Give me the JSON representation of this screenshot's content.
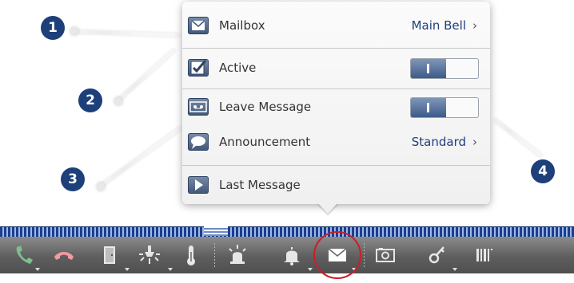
{
  "callouts": [
    "1",
    "2",
    "3",
    "4"
  ],
  "menu": {
    "rows": [
      {
        "label": "Mailbox",
        "value": "Main Bell",
        "icon": "envelope-icon"
      },
      {
        "label": "Active",
        "control": "toggle",
        "state": "on",
        "icon": "checkbox-icon"
      },
      {
        "label": "Leave Message",
        "control": "toggle",
        "state": "on",
        "icon": "tape-icon"
      },
      {
        "label": "Announcement",
        "value": "Standard",
        "icon": "speech-bubble-icon"
      },
      {
        "label": "Last Message",
        "icon": "play-icon"
      }
    ],
    "chevron": "›"
  },
  "toolbar": {
    "items": [
      "phone-accept-icon",
      "phone-hangup-icon",
      "door-icon",
      "light-icon",
      "thermometer-icon",
      "alarm-light-icon",
      "bell-icon",
      "mailbox-icon",
      "camera-icon",
      "key-icon",
      "barcode-icon"
    ],
    "selected": "mailbox-icon",
    "colors": {
      "accent": "#cc1d2a",
      "brand": "#1d3f7a"
    }
  }
}
